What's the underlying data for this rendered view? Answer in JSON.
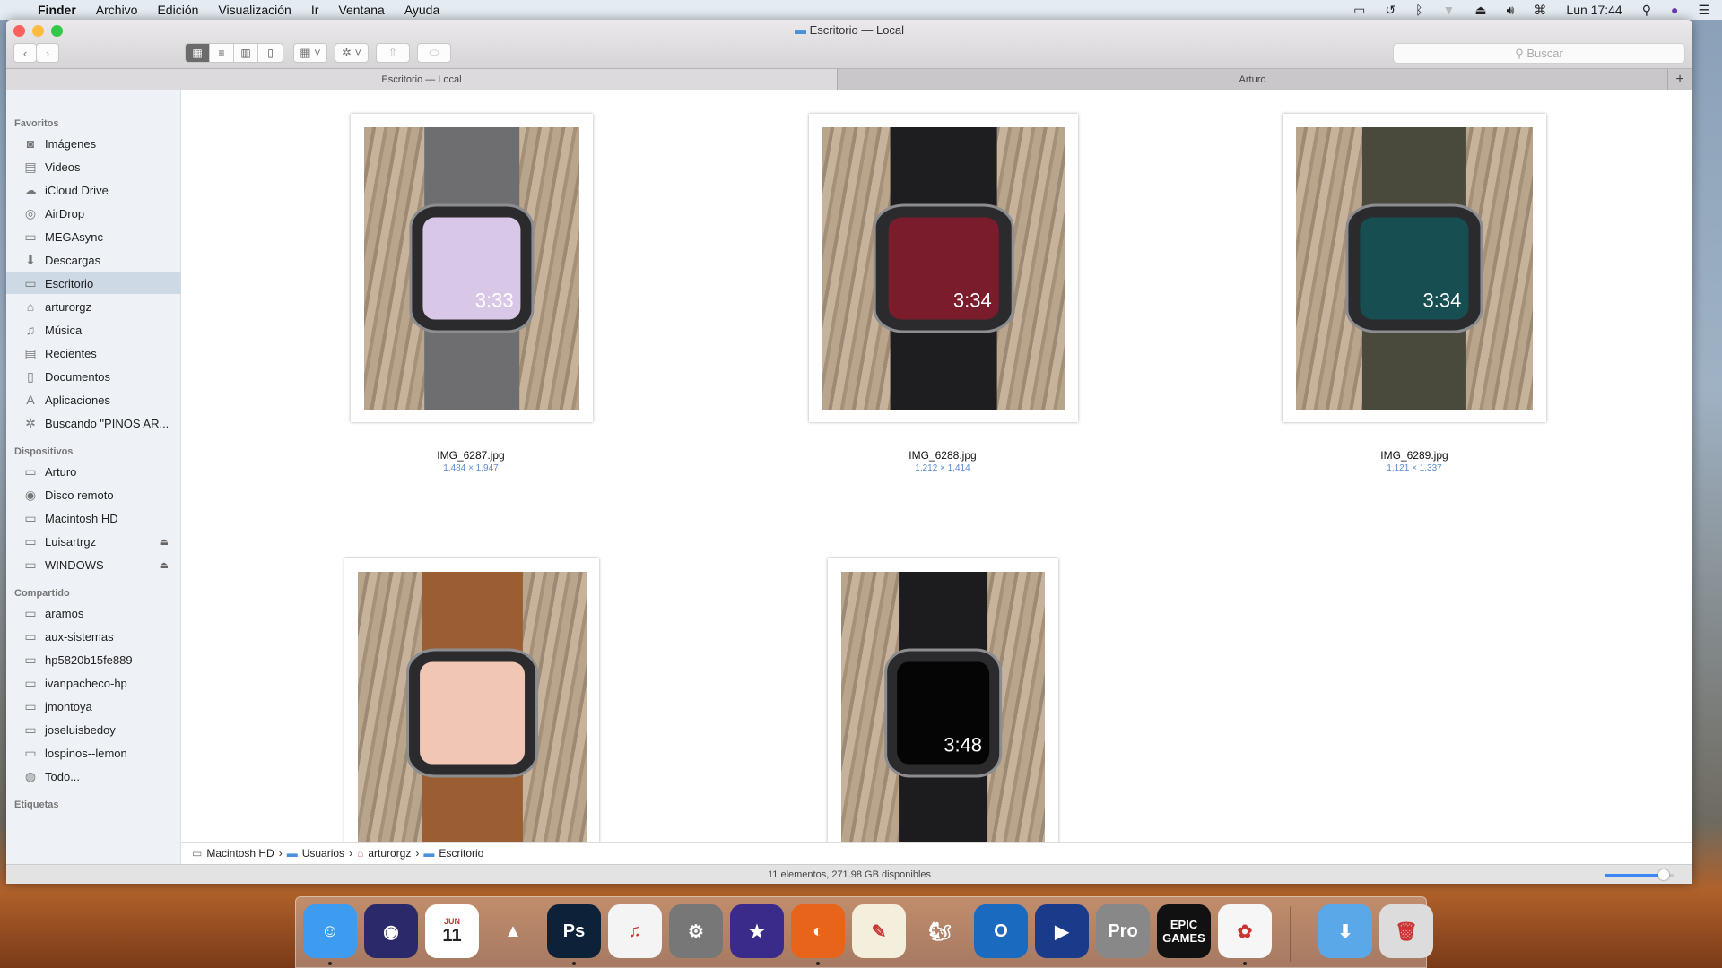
{
  "menubar": {
    "app": "Finder",
    "items": [
      "Archivo",
      "Edición",
      "Visualización",
      "Ir",
      "Ventana",
      "Ayuda"
    ],
    "clock": "Lun 17:44"
  },
  "window": {
    "title": "Escritorio — Local",
    "search_placeholder": "Buscar",
    "tabs": [
      {
        "label": "Escritorio — Local",
        "active": false
      },
      {
        "label": "Arturo",
        "active": true
      }
    ],
    "view_mode": "icons"
  },
  "sidebar": {
    "favoritos_label": "Favoritos",
    "favoritos": [
      {
        "label": "Imágenes",
        "icon": "camera-icon",
        "glyph": "◙"
      },
      {
        "label": "Videos",
        "icon": "film-icon",
        "glyph": "▤"
      },
      {
        "label": "iCloud Drive",
        "icon": "cloud-icon",
        "glyph": "☁"
      },
      {
        "label": "AirDrop",
        "icon": "airdrop-icon",
        "glyph": "◎"
      },
      {
        "label": "MEGAsync",
        "icon": "folder-icon",
        "glyph": "▭"
      },
      {
        "label": "Descargas",
        "icon": "download-icon",
        "glyph": "⬇"
      },
      {
        "label": "Escritorio",
        "icon": "desktop-icon",
        "glyph": "▭",
        "selected": true
      },
      {
        "label": "arturorgz",
        "icon": "home-icon",
        "glyph": "⌂"
      },
      {
        "label": "Música",
        "icon": "music-icon",
        "glyph": "♫"
      },
      {
        "label": "Recientes",
        "icon": "recents-icon",
        "glyph": "▤"
      },
      {
        "label": "Documentos",
        "icon": "document-icon",
        "glyph": "▯"
      },
      {
        "label": "Aplicaciones",
        "icon": "applications-icon",
        "glyph": "A"
      },
      {
        "label": "Buscando \"PINOS AR...",
        "icon": "gear-icon",
        "glyph": "✲"
      }
    ],
    "dispositivos_label": "Dispositivos",
    "dispositivos": [
      {
        "label": "Arturo",
        "icon": "computer-icon",
        "glyph": "▭"
      },
      {
        "label": "Disco remoto",
        "icon": "disc-icon",
        "glyph": "◉"
      },
      {
        "label": "Macintosh HD",
        "icon": "harddisk-icon",
        "glyph": "▭"
      },
      {
        "label": "Luisartrgz",
        "icon": "drive-icon",
        "glyph": "▭",
        "eject": "⏏"
      },
      {
        "label": "WINDOWS",
        "icon": "drive-icon",
        "glyph": "▭",
        "eject": "⏏"
      }
    ],
    "compartido_label": "Compartido",
    "compartido": [
      {
        "label": "aramos"
      },
      {
        "label": "aux-sistemas"
      },
      {
        "label": "hp5820b15fe889"
      },
      {
        "label": "ivanpacheco-hp"
      },
      {
        "label": "jmontoya"
      },
      {
        "label": "joseluisbedoy"
      },
      {
        "label": "lospinos--lemon"
      },
      {
        "label": "Todo...",
        "icon": "globe-icon",
        "glyph": "◍"
      }
    ],
    "etiquetas_label": "Etiquetas"
  },
  "files": [
    {
      "name": "IMG_6287.jpg",
      "dims": "1,484 × 1,947",
      "band": "#6e6e70",
      "screen": "#d9c7e8",
      "time": "3:33"
    },
    {
      "name": "IMG_6288.jpg",
      "dims": "1,212 × 1,414",
      "band": "#1e1e20",
      "screen": "#7a1c2c",
      "time": "3:34"
    },
    {
      "name": "IMG_6289.jpg",
      "dims": "1,121 × 1,337",
      "band": "#4a4a3c",
      "screen": "#164e52",
      "time": "3:34"
    },
    {
      "name": "",
      "dims": "",
      "band": "#9a5e32",
      "screen": "#f1c6b4",
      "time": ""
    },
    {
      "name": "",
      "dims": "",
      "band": "#1c1c1e",
      "screen": "#050505",
      "time": "3:48"
    }
  ],
  "pathbar": [
    "Macintosh HD",
    "Usuarios",
    "arturorgz",
    "Escritorio"
  ],
  "status": {
    "text": "11 elementos, 271.98 GB disponibles",
    "icon_size": 0.85
  },
  "dock": [
    {
      "name": "finder",
      "bg": "#3d9cf0",
      "label": "☺"
    },
    {
      "name": "siri",
      "bg": "#2a2a6a",
      "label": "◉"
    },
    {
      "name": "calendar",
      "bg": "#ffffff",
      "label": "11",
      "sub": "JUN"
    },
    {
      "name": "vlc",
      "bg": "transparent",
      "label": "▲"
    },
    {
      "name": "photoshop",
      "bg": "#0d2238",
      "label": "Ps"
    },
    {
      "name": "itunes",
      "bg": "#f4f4f4",
      "label": "♫"
    },
    {
      "name": "system-preferences",
      "bg": "#777",
      "label": "⚙"
    },
    {
      "name": "imovie",
      "bg": "#3a2a8a",
      "label": "★"
    },
    {
      "name": "firefox",
      "bg": "#e8641a",
      "label": "◐"
    },
    {
      "name": "pages",
      "bg": "#f4eedc",
      "label": "✎"
    },
    {
      "name": "squirrel-app",
      "bg": "transparent",
      "label": "🐿"
    },
    {
      "name": "outlook",
      "bg": "#1a6ac0",
      "label": "O"
    },
    {
      "name": "screen-recorder",
      "bg": "#1a3a8a",
      "label": "▶"
    },
    {
      "name": "google-earth-pro",
      "bg": "#888",
      "label": "Pro"
    },
    {
      "name": "epic-games",
      "bg": "#111",
      "label": "EPIC GAMES"
    },
    {
      "name": "photos",
      "bg": "#f6f6f6",
      "label": "✿"
    },
    {
      "name": "downloads-folder",
      "bg": "#5aa8e8",
      "label": "⬇"
    },
    {
      "name": "trash",
      "bg": "#dcdcdc",
      "label": "🗑"
    }
  ]
}
